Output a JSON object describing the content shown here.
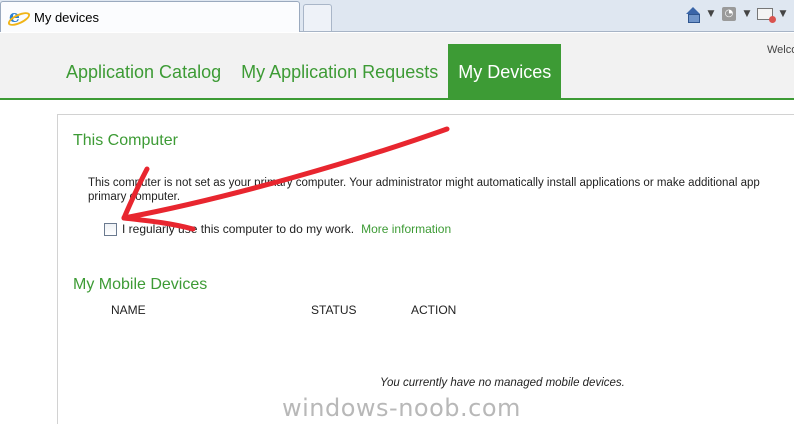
{
  "browser": {
    "tab_title": "My devices",
    "icons": [
      "ie-logo-icon",
      "home-icon",
      "chevron-down-icon",
      "rss-feed-icon",
      "chevron-down-icon",
      "read-mail-icon",
      "chevron-down-icon"
    ]
  },
  "header": {
    "welcome": "Welco",
    "nav": [
      {
        "label": "Application Catalog"
      },
      {
        "label": "My Application Requests"
      },
      {
        "label": "My Devices"
      }
    ]
  },
  "this_computer": {
    "title": "This Computer",
    "line1": "This computer is not set as your primary computer. Your administrator might automatically install applications or make additional app",
    "line2": "primary computer.",
    "checkbox_label": "I regularly use this computer to do my work.",
    "checkbox_checked": false,
    "more_info": "More information"
  },
  "mobile_devices": {
    "title": "My Mobile Devices",
    "columns": [
      "NAME",
      "STATUS",
      "ACTION"
    ],
    "empty_message": "You currently have no managed mobile devices."
  },
  "annotation": {
    "arrow_color": "#e8262f"
  },
  "watermark": "windows-noob.com"
}
